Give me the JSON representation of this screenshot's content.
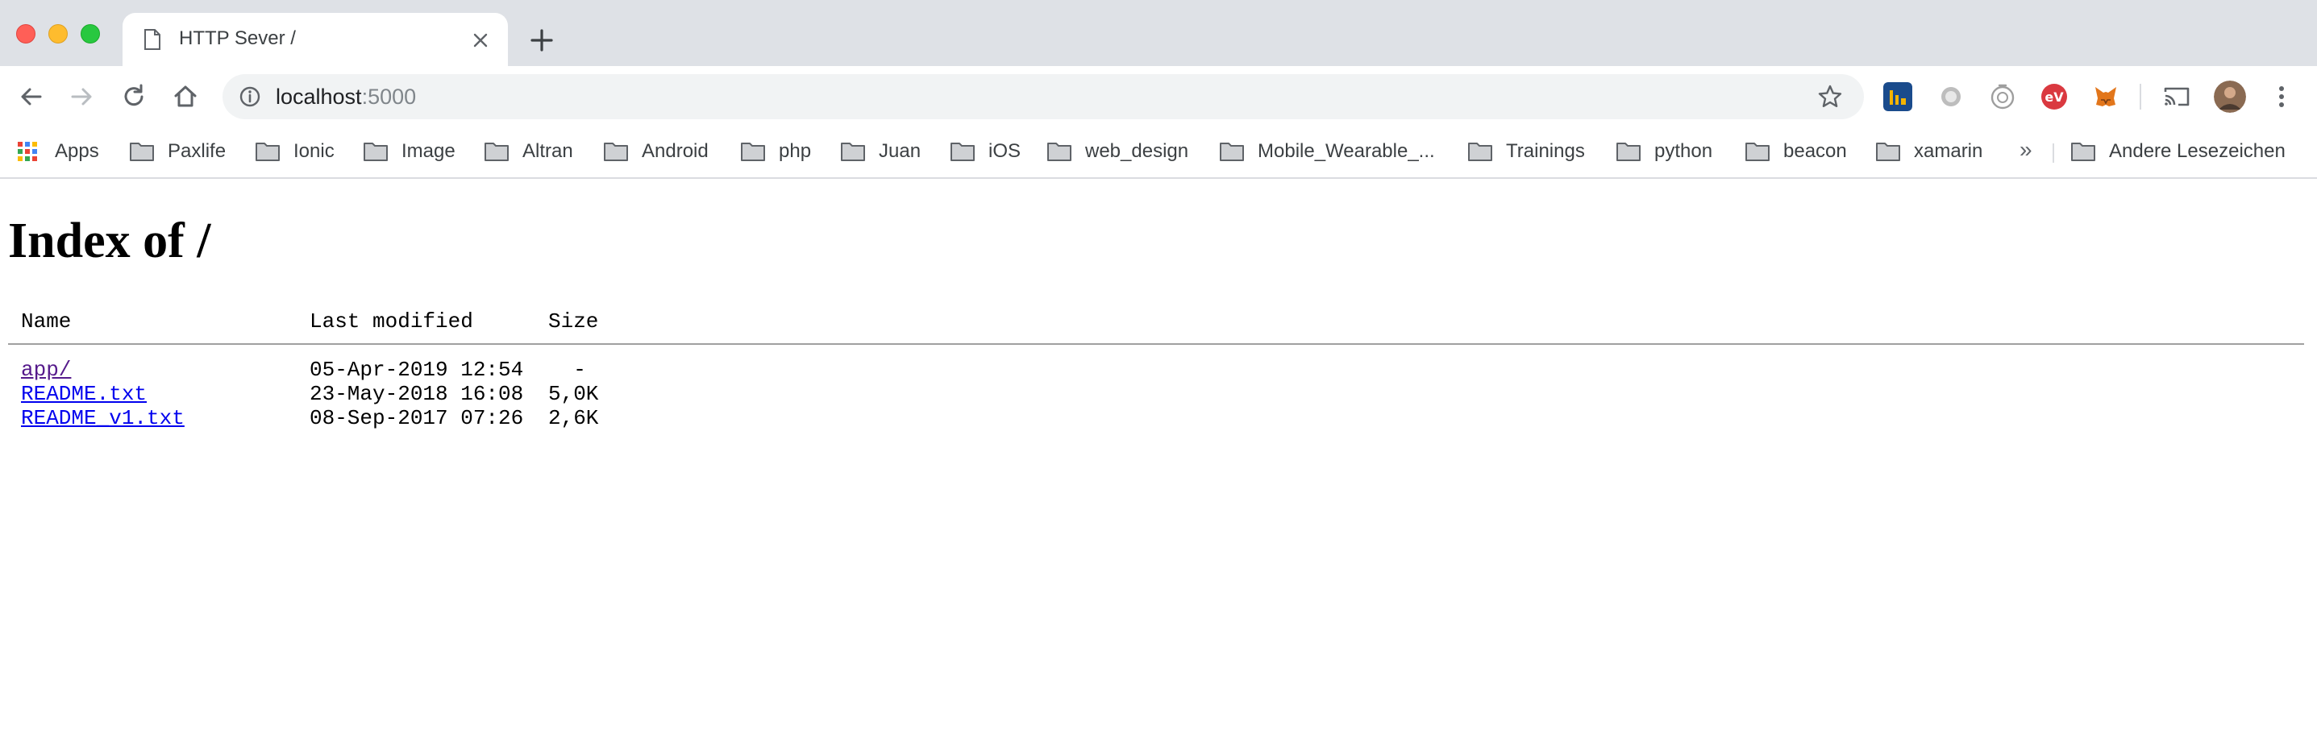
{
  "browser": {
    "tab": {
      "title": "HTTP Sever /",
      "icon": "document-icon"
    },
    "address": {
      "host": "localhost",
      "port": ":5000"
    },
    "extensions": [
      "analytics-extension-icon",
      "circle-extension-icon",
      "timer-extension-icon",
      "expressvpn-extension-icon",
      "metamask-extension-icon"
    ],
    "bookmarks": {
      "apps_label": "Apps",
      "folders": [
        "Paxlife",
        "Ionic",
        "Image",
        "Altran",
        "Android",
        "php",
        "Juan",
        "iOS",
        "web_design",
        "Mobile_Wearable_...",
        "Trainings",
        "python",
        "beacon",
        "xamarin"
      ],
      "overflow": "»",
      "other": "Andere Lesezeichen"
    }
  },
  "page": {
    "title": "Index of /",
    "columns": {
      "name": "Name",
      "modified": "Last modified",
      "size": "Size"
    },
    "entries": [
      {
        "name": "app/",
        "modified": "05-Apr-2019 12:54",
        "size": "  -"
      },
      {
        "name": "README.txt",
        "modified": "23-May-2018 16:08",
        "size": "5,0K"
      },
      {
        "name": "README_v1.txt",
        "modified": "08-Sep-2017 07:26",
        "size": "2,6K"
      }
    ]
  },
  "colors": {
    "tabstrip": "#dee1e6",
    "link": "#0000ee",
    "visited_link": "#551a8b"
  }
}
